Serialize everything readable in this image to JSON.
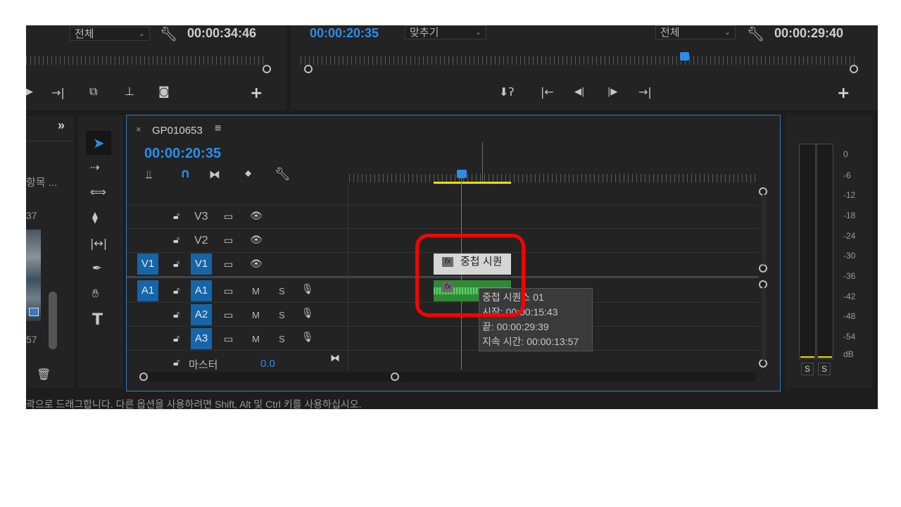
{
  "source_monitor": {
    "fit_select": "전체",
    "timecode": "00:00:34:46"
  },
  "program_monitor": {
    "current_timecode": "00:00:20:35",
    "fit_select": "맞추기",
    "quality_select": "전체",
    "duration_timecode": "00:00:29:40",
    "playhead_position": 0.7
  },
  "project_panel": {
    "expand_label": "»",
    "items_label": "항목 ...",
    "thumb_count_top": "37",
    "thumb_count_bottom": "57"
  },
  "timeline": {
    "sequence_name": "GP010653",
    "close_label": "×",
    "menu_label": "≡",
    "timecode": "00:00:20:35",
    "tracks": {
      "v3": "V3",
      "v2": "V2",
      "v1_source": "V1",
      "v1": "V1",
      "a1_source": "A1",
      "a1": "A1",
      "a2": "A2",
      "a3": "A3",
      "mute": "M",
      "solo": "S"
    },
    "master_label": "마스터",
    "master_value": "0.0",
    "clip_video_label": "중첩 시퀀",
    "fx_label": "fx",
    "tooltip": {
      "name": "중첩 시퀀스 01",
      "start": "시작: 00:00:15:43",
      "end": "끝: 00:00:29:39",
      "duration": "지속 시간: 00:00:13:57"
    }
  },
  "audio_meter": {
    "scale": [
      "0",
      "-6",
      "-12",
      "-18",
      "-24",
      "-30",
      "-36",
      "-42",
      "-48",
      "-54",
      "dB"
    ],
    "solo_left": "S",
    "solo_right": "S"
  },
  "status_bar": {
    "text": "곽으로 드래그합니다. 다른 옵션을 사용하려면 Shift, Alt 및 Ctrl 키를 사용하십시오."
  },
  "colors": {
    "accent_blue": "#2d8ceb",
    "track_blue": "#1565a8",
    "annotation_red": "#ff0000",
    "audio_clip_green": "#39a03f",
    "work_area_yellow": "#e8e000"
  }
}
